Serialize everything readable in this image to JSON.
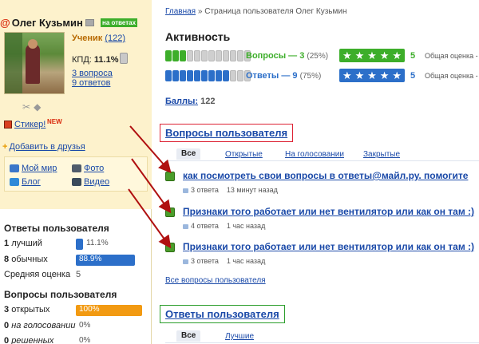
{
  "profile": {
    "name": "Олег Кузьмин",
    "at_symbol": "@",
    "badge": "на ответах",
    "rank_label": "Ученик",
    "rank_score": "(122)",
    "kpd_label": "КПД:",
    "kpd_value": "11.1%",
    "questions_link": "3 вопроса",
    "answers_link": "9 ответов",
    "sticker_link": "Стикер!",
    "sticker_new": "NEW",
    "add_friend_link": "Добавить в друзья",
    "links": {
      "world": "Мой мир",
      "photo": "Фото",
      "blog": "Блог",
      "video": "Видео"
    }
  },
  "answers_stats": {
    "title": "Ответы пользователя",
    "rows": [
      {
        "count": "1",
        "label": "лучший",
        "value": "11.1%",
        "fill": 0.111
      },
      {
        "count": "8",
        "label": "обычных",
        "value": "88.9%",
        "fill": 0.889
      }
    ],
    "avg_label": "Средняя оценка",
    "avg_value": "5"
  },
  "questions_stats": {
    "title": "Вопросы пользователя",
    "rows": [
      {
        "count": "3",
        "label": "открытых",
        "value": "100%",
        "fill": 1.0
      },
      {
        "count": "0",
        "label": "на голосовании",
        "value": "0%",
        "fill": 0.0
      },
      {
        "count": "0",
        "label": "решенных",
        "value": "0%",
        "fill": 0.0
      }
    ]
  },
  "breadcrumb": {
    "home": "Главная",
    "separator": "»",
    "current": "Страница пользователя Олег Кузьмин"
  },
  "activity": {
    "title": "Активность",
    "questions": {
      "label": "Вопросы — 3",
      "pct": "(25%)",
      "filled": 3,
      "total": 12,
      "rating": "5",
      "rating_label": "Общая оценка -",
      "color": "#3dae2a"
    },
    "answers": {
      "label": "Ответы — 9",
      "pct": "(75%)",
      "filled": 9,
      "total": 12,
      "rating": "5",
      "rating_label": "Общая оценка -",
      "color": "#2c6fc9"
    },
    "points_label": "Баллы:",
    "points_value": "122"
  },
  "questions_section": {
    "title": "Вопросы пользователя",
    "tabs": [
      "Все",
      "Открытые",
      "На голосовании",
      "Закрытые"
    ],
    "items": [
      {
        "title": "как посмотреть свои вопросы в ответы@майл.ру. помогите",
        "answers": "3 ответа",
        "time": "13 минут назад"
      },
      {
        "title": "Признаки того работает или нет вентилятор или как он там :)",
        "answers": "4 ответа",
        "time": "1 час назад"
      },
      {
        "title": "Признаки того работает или нет вентилятор или как он там :)",
        "answers": "3 ответа",
        "time": "1 час назад"
      }
    ],
    "all_link": "Все вопросы пользователя"
  },
  "answers_section": {
    "title": "Ответы пользователя",
    "tabs": [
      "Все",
      "Лучшие"
    ]
  },
  "colors": {
    "accent_blue": "#1a49a8",
    "green": "#3dae2a",
    "blue_bar": "#2c6fc9",
    "orange_bar": "#f29a12",
    "highlight_red": "#d23",
    "highlight_green": "#2a9d2a",
    "arrow": "#b01010",
    "profile_bg": "#fdf2cc"
  }
}
